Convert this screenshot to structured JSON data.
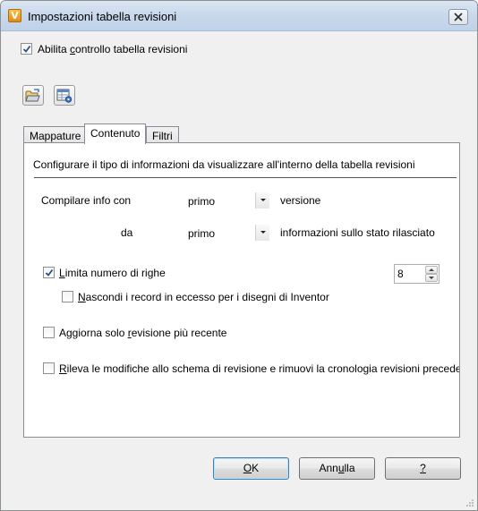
{
  "window": {
    "title": "Impostazioni tabella revisioni",
    "app_icon_letter": "V"
  },
  "enable_checkbox": {
    "pre": "Abilita ",
    "accel": "c",
    "post": "ontrollo tabella revisioni",
    "checked": true
  },
  "toolbar": {
    "icons": [
      "open-folder-icon",
      "table-settings-icon"
    ]
  },
  "tabs": [
    {
      "label": "Mappature",
      "active": false
    },
    {
      "label": "Contenuto",
      "active": true
    },
    {
      "label": "Filtri",
      "active": false
    }
  ],
  "content": {
    "description": "Configurare il tipo di informazioni da visualizzare all'interno della tabella revisioni",
    "compile_label": "Compilare info con",
    "compile_value": "primo",
    "compile_suffix": "versione",
    "from_label": "da",
    "from_value": "primo",
    "from_suffix": "informazioni sullo stato rilasciato",
    "limit_rows": {
      "accel": "L",
      "rest": "imita numero di righe",
      "checked": true,
      "value": "8"
    },
    "hide_records": {
      "accel": "N",
      "rest": "ascondi i record in eccesso per i disegni di Inventor",
      "checked": false
    },
    "update_latest": {
      "pre": "Aggiorna solo ",
      "accel": "r",
      "post": "evisione più recente",
      "checked": false
    },
    "detect_changes": {
      "accel": "R",
      "rest": "ileva le modifiche allo schema di revisione e rimuovi la cronologia revisioni precede",
      "checked": false
    }
  },
  "buttons": {
    "ok_accel": "O",
    "ok_rest": "K",
    "cancel_pre": "Ann",
    "cancel_accel": "u",
    "cancel_post": "lla",
    "help_accel": "?"
  },
  "colors": {
    "title_gradient_top": "#dbe6f3",
    "default_button_border": "#3c7fb1",
    "check_mark": "#2a4e86"
  }
}
